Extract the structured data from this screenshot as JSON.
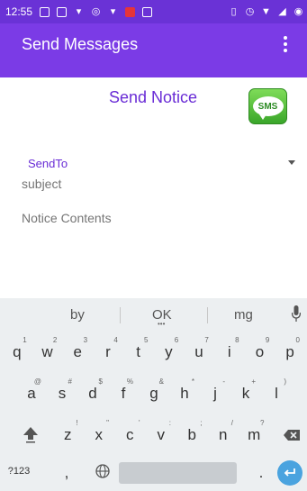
{
  "status_bar": {
    "time": "12:55",
    "icons": [
      "mail-icon",
      "mail-icon",
      "twitter-icon",
      "whatsapp-icon",
      "twitter-icon",
      "app-badge-icon",
      "image-icon",
      "vibrate-icon",
      "alarm-icon",
      "wifi-icon",
      "signal-icon",
      "battery-icon"
    ]
  },
  "app_bar": {
    "title": "Send Messages"
  },
  "form": {
    "notice_title": "Send Notice",
    "sms_badge": "SMS",
    "sendto_label": "SendTo",
    "subject_placeholder": "subject",
    "contents_placeholder": "Notice Contents"
  },
  "keyboard": {
    "suggestions": [
      "by",
      "OK",
      "mg"
    ],
    "row1": [
      {
        "key": "q",
        "hint": "1"
      },
      {
        "key": "w",
        "hint": "2"
      },
      {
        "key": "e",
        "hint": "3"
      },
      {
        "key": "r",
        "hint": "4"
      },
      {
        "key": "t",
        "hint": "5"
      },
      {
        "key": "y",
        "hint": "6"
      },
      {
        "key": "u",
        "hint": "7"
      },
      {
        "key": "i",
        "hint": "8"
      },
      {
        "key": "o",
        "hint": "9"
      },
      {
        "key": "p",
        "hint": "0"
      }
    ],
    "row2": [
      {
        "key": "a",
        "hint": "@"
      },
      {
        "key": "s",
        "hint": "#"
      },
      {
        "key": "d",
        "hint": "$"
      },
      {
        "key": "f",
        "hint": "%"
      },
      {
        "key": "g",
        "hint": "&"
      },
      {
        "key": "h",
        "hint": "*"
      },
      {
        "key": "j",
        "hint": "-"
      },
      {
        "key": "k",
        "hint": "+"
      },
      {
        "key": "l",
        "hint": ")"
      }
    ],
    "row3": [
      {
        "key": "z",
        "hint": "!"
      },
      {
        "key": "x",
        "hint": "\""
      },
      {
        "key": "c",
        "hint": "'"
      },
      {
        "key": "v",
        "hint": ":"
      },
      {
        "key": "b",
        "hint": ";"
      },
      {
        "key": "n",
        "hint": "/"
      },
      {
        "key": "m",
        "hint": "?"
      }
    ],
    "symbols_label": "?123",
    "comma": ",",
    "period": "."
  }
}
